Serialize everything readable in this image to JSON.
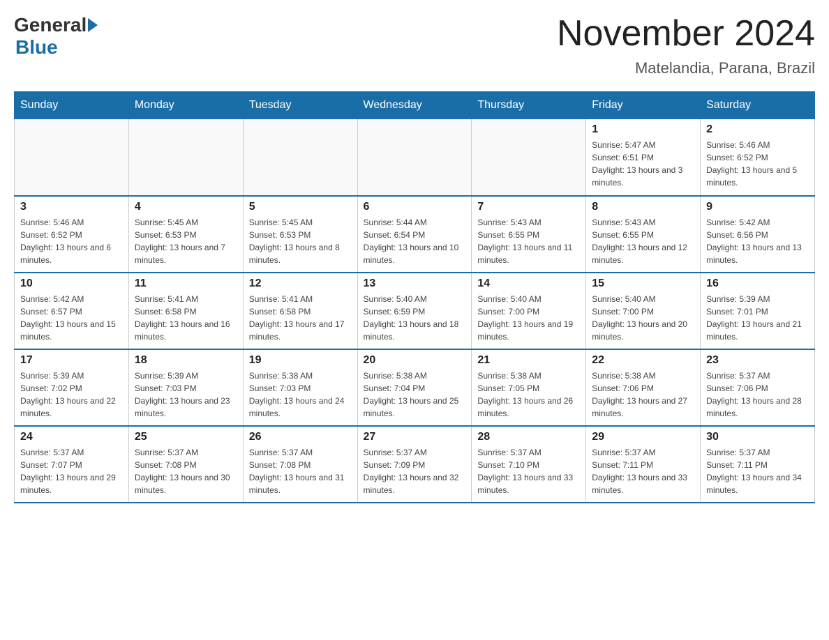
{
  "header": {
    "logo_general": "General",
    "logo_blue": "Blue",
    "month_title": "November 2024",
    "location": "Matelandia, Parana, Brazil"
  },
  "days_of_week": [
    "Sunday",
    "Monday",
    "Tuesday",
    "Wednesday",
    "Thursday",
    "Friday",
    "Saturday"
  ],
  "weeks": [
    [
      {
        "day": "",
        "sunrise": "",
        "sunset": "",
        "daylight": ""
      },
      {
        "day": "",
        "sunrise": "",
        "sunset": "",
        "daylight": ""
      },
      {
        "day": "",
        "sunrise": "",
        "sunset": "",
        "daylight": ""
      },
      {
        "day": "",
        "sunrise": "",
        "sunset": "",
        "daylight": ""
      },
      {
        "day": "",
        "sunrise": "",
        "sunset": "",
        "daylight": ""
      },
      {
        "day": "1",
        "sunrise": "Sunrise: 5:47 AM",
        "sunset": "Sunset: 6:51 PM",
        "daylight": "Daylight: 13 hours and 3 minutes."
      },
      {
        "day": "2",
        "sunrise": "Sunrise: 5:46 AM",
        "sunset": "Sunset: 6:52 PM",
        "daylight": "Daylight: 13 hours and 5 minutes."
      }
    ],
    [
      {
        "day": "3",
        "sunrise": "Sunrise: 5:46 AM",
        "sunset": "Sunset: 6:52 PM",
        "daylight": "Daylight: 13 hours and 6 minutes."
      },
      {
        "day": "4",
        "sunrise": "Sunrise: 5:45 AM",
        "sunset": "Sunset: 6:53 PM",
        "daylight": "Daylight: 13 hours and 7 minutes."
      },
      {
        "day": "5",
        "sunrise": "Sunrise: 5:45 AM",
        "sunset": "Sunset: 6:53 PM",
        "daylight": "Daylight: 13 hours and 8 minutes."
      },
      {
        "day": "6",
        "sunrise": "Sunrise: 5:44 AM",
        "sunset": "Sunset: 6:54 PM",
        "daylight": "Daylight: 13 hours and 10 minutes."
      },
      {
        "day": "7",
        "sunrise": "Sunrise: 5:43 AM",
        "sunset": "Sunset: 6:55 PM",
        "daylight": "Daylight: 13 hours and 11 minutes."
      },
      {
        "day": "8",
        "sunrise": "Sunrise: 5:43 AM",
        "sunset": "Sunset: 6:55 PM",
        "daylight": "Daylight: 13 hours and 12 minutes."
      },
      {
        "day": "9",
        "sunrise": "Sunrise: 5:42 AM",
        "sunset": "Sunset: 6:56 PM",
        "daylight": "Daylight: 13 hours and 13 minutes."
      }
    ],
    [
      {
        "day": "10",
        "sunrise": "Sunrise: 5:42 AM",
        "sunset": "Sunset: 6:57 PM",
        "daylight": "Daylight: 13 hours and 15 minutes."
      },
      {
        "day": "11",
        "sunrise": "Sunrise: 5:41 AM",
        "sunset": "Sunset: 6:58 PM",
        "daylight": "Daylight: 13 hours and 16 minutes."
      },
      {
        "day": "12",
        "sunrise": "Sunrise: 5:41 AM",
        "sunset": "Sunset: 6:58 PM",
        "daylight": "Daylight: 13 hours and 17 minutes."
      },
      {
        "day": "13",
        "sunrise": "Sunrise: 5:40 AM",
        "sunset": "Sunset: 6:59 PM",
        "daylight": "Daylight: 13 hours and 18 minutes."
      },
      {
        "day": "14",
        "sunrise": "Sunrise: 5:40 AM",
        "sunset": "Sunset: 7:00 PM",
        "daylight": "Daylight: 13 hours and 19 minutes."
      },
      {
        "day": "15",
        "sunrise": "Sunrise: 5:40 AM",
        "sunset": "Sunset: 7:00 PM",
        "daylight": "Daylight: 13 hours and 20 minutes."
      },
      {
        "day": "16",
        "sunrise": "Sunrise: 5:39 AM",
        "sunset": "Sunset: 7:01 PM",
        "daylight": "Daylight: 13 hours and 21 minutes."
      }
    ],
    [
      {
        "day": "17",
        "sunrise": "Sunrise: 5:39 AM",
        "sunset": "Sunset: 7:02 PM",
        "daylight": "Daylight: 13 hours and 22 minutes."
      },
      {
        "day": "18",
        "sunrise": "Sunrise: 5:39 AM",
        "sunset": "Sunset: 7:03 PM",
        "daylight": "Daylight: 13 hours and 23 minutes."
      },
      {
        "day": "19",
        "sunrise": "Sunrise: 5:38 AM",
        "sunset": "Sunset: 7:03 PM",
        "daylight": "Daylight: 13 hours and 24 minutes."
      },
      {
        "day": "20",
        "sunrise": "Sunrise: 5:38 AM",
        "sunset": "Sunset: 7:04 PM",
        "daylight": "Daylight: 13 hours and 25 minutes."
      },
      {
        "day": "21",
        "sunrise": "Sunrise: 5:38 AM",
        "sunset": "Sunset: 7:05 PM",
        "daylight": "Daylight: 13 hours and 26 minutes."
      },
      {
        "day": "22",
        "sunrise": "Sunrise: 5:38 AM",
        "sunset": "Sunset: 7:06 PM",
        "daylight": "Daylight: 13 hours and 27 minutes."
      },
      {
        "day": "23",
        "sunrise": "Sunrise: 5:37 AM",
        "sunset": "Sunset: 7:06 PM",
        "daylight": "Daylight: 13 hours and 28 minutes."
      }
    ],
    [
      {
        "day": "24",
        "sunrise": "Sunrise: 5:37 AM",
        "sunset": "Sunset: 7:07 PM",
        "daylight": "Daylight: 13 hours and 29 minutes."
      },
      {
        "day": "25",
        "sunrise": "Sunrise: 5:37 AM",
        "sunset": "Sunset: 7:08 PM",
        "daylight": "Daylight: 13 hours and 30 minutes."
      },
      {
        "day": "26",
        "sunrise": "Sunrise: 5:37 AM",
        "sunset": "Sunset: 7:08 PM",
        "daylight": "Daylight: 13 hours and 31 minutes."
      },
      {
        "day": "27",
        "sunrise": "Sunrise: 5:37 AM",
        "sunset": "Sunset: 7:09 PM",
        "daylight": "Daylight: 13 hours and 32 minutes."
      },
      {
        "day": "28",
        "sunrise": "Sunrise: 5:37 AM",
        "sunset": "Sunset: 7:10 PM",
        "daylight": "Daylight: 13 hours and 33 minutes."
      },
      {
        "day": "29",
        "sunrise": "Sunrise: 5:37 AM",
        "sunset": "Sunset: 7:11 PM",
        "daylight": "Daylight: 13 hours and 33 minutes."
      },
      {
        "day": "30",
        "sunrise": "Sunrise: 5:37 AM",
        "sunset": "Sunset: 7:11 PM",
        "daylight": "Daylight: 13 hours and 34 minutes."
      }
    ]
  ]
}
